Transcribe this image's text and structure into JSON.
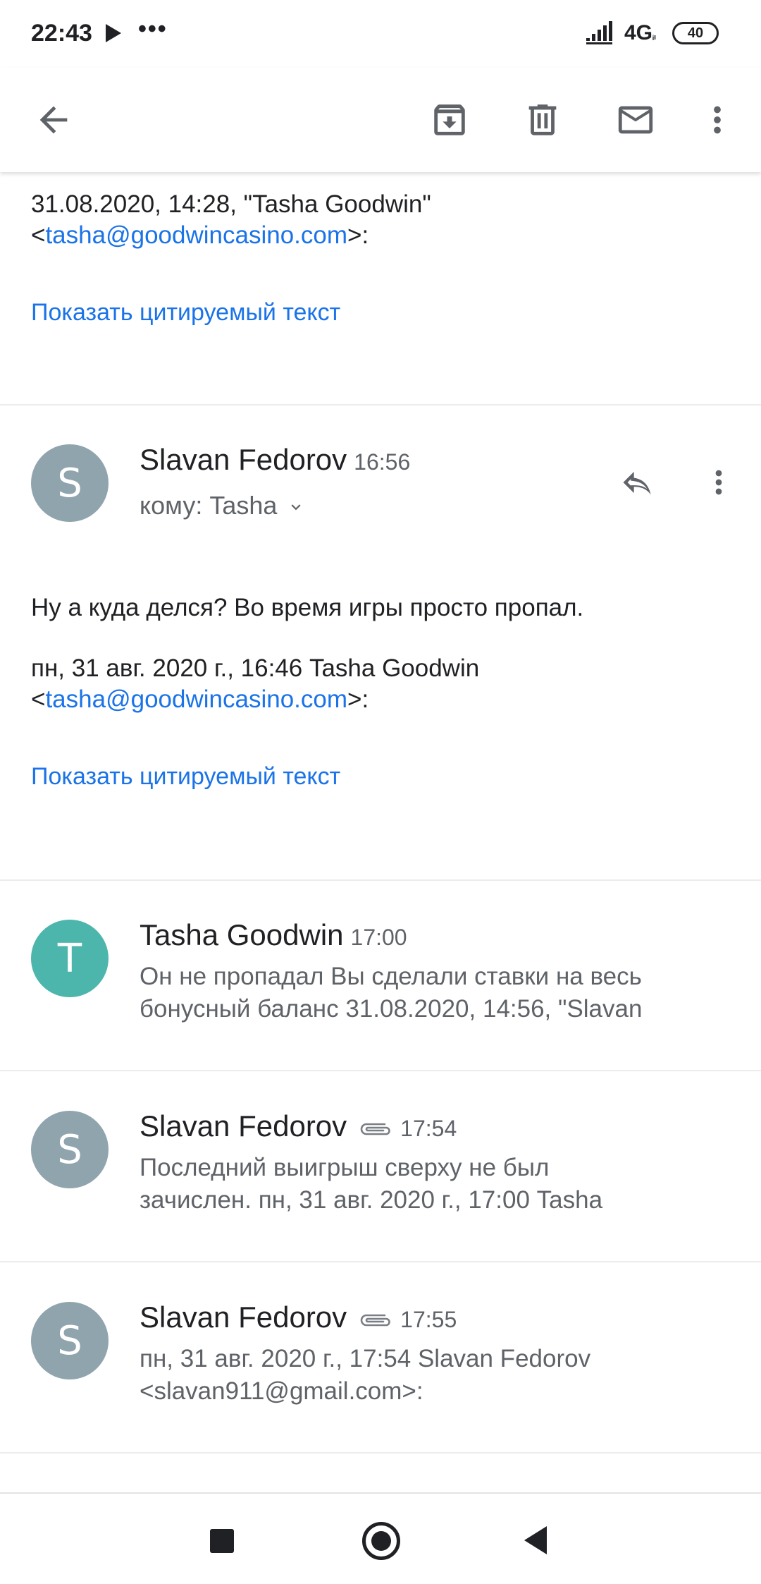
{
  "status_bar": {
    "time": "22:43",
    "more": "•••",
    "network": "4G",
    "network_sub": "ᵢₗ",
    "battery": "40"
  },
  "toolbar": {
    "back_icon": "arrow-back-icon",
    "archive_icon": "archive-icon",
    "delete_icon": "trash-icon",
    "mark_unread_icon": "mail-icon",
    "more_icon": "more-vert-icon"
  },
  "quote_top": {
    "line1": "31.08.2020, 14:28, \"Tasha Goodwin\"",
    "email_prefix": "<",
    "email": "tasha@goodwincasino.com",
    "email_suffix": ">:",
    "show_quoted": "Показать цитируемый текст"
  },
  "expanded_message": {
    "avatar_letter": "S",
    "avatar_color": "#90a4ae",
    "sender": "Slavan Fedorov",
    "time": "16:56",
    "recipient": "кому: Tasha",
    "body": "Ну а куда делся? Во время игры просто пропал.",
    "quote_line": "пн, 31 авг. 2020 г., 16:46 Tasha Goodwin",
    "email_prefix": "<",
    "email": "tasha@goodwincasino.com",
    "email_suffix": ">:",
    "show_quoted": "Показать цитируемый текст"
  },
  "messages": [
    {
      "avatar_letter": "T",
      "avatar_color": "#4db6ac",
      "sender": "Tasha Goodwin",
      "time": "17:00",
      "has_attachment": false,
      "snippet_line1": "Он не пропадал Вы сделали ставки на весь",
      "snippet_line2": "бонусный баланс 31.08.2020, 14:56, \"Slavan"
    },
    {
      "avatar_letter": "S",
      "avatar_color": "#90a4ae",
      "sender": "Slavan Fedorov",
      "time": "17:54",
      "has_attachment": true,
      "snippet_line1": "Последний выигрыш сверху не был",
      "snippet_line2": "зачислен. пн, 31 авг. 2020 г., 17:00 Tasha"
    },
    {
      "avatar_letter": "S",
      "avatar_color": "#90a4ae",
      "sender": "Slavan Fedorov",
      "time": "17:55",
      "has_attachment": true,
      "snippet_line1": "пн, 31 авг. 2020 г., 17:54 Slavan Fedorov",
      "snippet_line2": "<slavan911@gmail.com>:"
    }
  ],
  "colors": {
    "link": "#1a73e8",
    "icon": "#5f6368"
  }
}
